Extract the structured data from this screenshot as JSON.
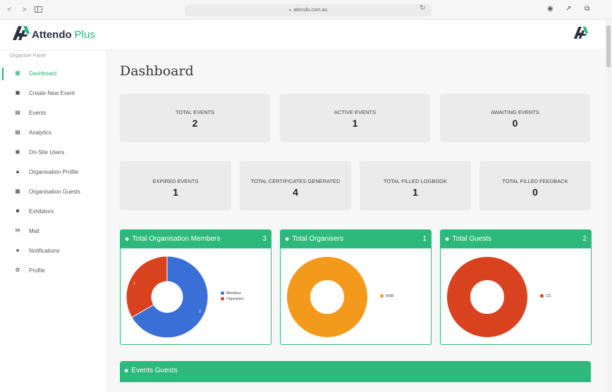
{
  "browser": {
    "url": "attendo.com.au"
  },
  "header": {
    "brand_name": "Attendo",
    "brand_suffix": "Plus",
    "brand_color": "#26b57a"
  },
  "sidebar": {
    "title": "Organiser Panel",
    "items": [
      {
        "label": "Dashboard",
        "icon": "dashboard-icon",
        "active": true
      },
      {
        "label": "Create New Event",
        "icon": "file-plus-icon"
      },
      {
        "label": "Events",
        "icon": "calendar-icon"
      },
      {
        "label": "Analytics",
        "icon": "chart-icon"
      },
      {
        "label": "On-Site Users",
        "icon": "user-db-icon"
      },
      {
        "label": "Organisation Profile",
        "icon": "building-icon"
      },
      {
        "label": "Organisation Guests",
        "icon": "guests-icon"
      },
      {
        "label": "Exhibitors",
        "icon": "briefcase-icon"
      },
      {
        "label": "Mail",
        "icon": "mail-icon"
      },
      {
        "label": "Notifications",
        "icon": "bell-icon"
      },
      {
        "label": "Profile",
        "icon": "gear-icon"
      }
    ]
  },
  "main": {
    "title": "Dashboard",
    "stats_row1": [
      {
        "label": "TOTAL EVENTS",
        "value": "2"
      },
      {
        "label": "ACTIVE EVENTS",
        "value": "1"
      },
      {
        "label": "AWAITING EVENTS",
        "value": "0"
      }
    ],
    "stats_row2": [
      {
        "label": "EXPIRED EVENTS",
        "value": "1"
      },
      {
        "label": "TOTAL CERTIFICATES GENERATED",
        "value": "4"
      },
      {
        "label": "TOTAL FILLED LOGBOOK",
        "value": "1"
      },
      {
        "label": "TOTAL FILLED FEEDBACK",
        "value": "0"
      }
    ],
    "events_guests_title": "Events Guests"
  },
  "colors": {
    "accent": "#2eb87c",
    "blue": "#3a6fd8",
    "red": "#d9421e",
    "orange": "#f39a1c"
  },
  "chart_data": [
    {
      "type": "pie",
      "title": "Total Organisation Members",
      "count": "3",
      "donut": true,
      "categories": [
        "Members",
        "Organisers"
      ],
      "values": [
        2,
        1
      ],
      "colors": [
        "#3a6fd8",
        "#d9421e"
      ],
      "data_labels": [
        "2",
        "1"
      ],
      "legend": "right"
    },
    {
      "type": "pie",
      "title": "Total Organisers",
      "count": "1",
      "donut": true,
      "categories": [
        "WSB"
      ],
      "values": [
        1
      ],
      "colors": [
        "#f39a1c"
      ],
      "legend": "right"
    },
    {
      "type": "pie",
      "title": "Total Guests",
      "count": "2",
      "donut": true,
      "categories": [
        "CG"
      ],
      "values": [
        2
      ],
      "colors": [
        "#d9421e"
      ],
      "legend": "right"
    }
  ]
}
